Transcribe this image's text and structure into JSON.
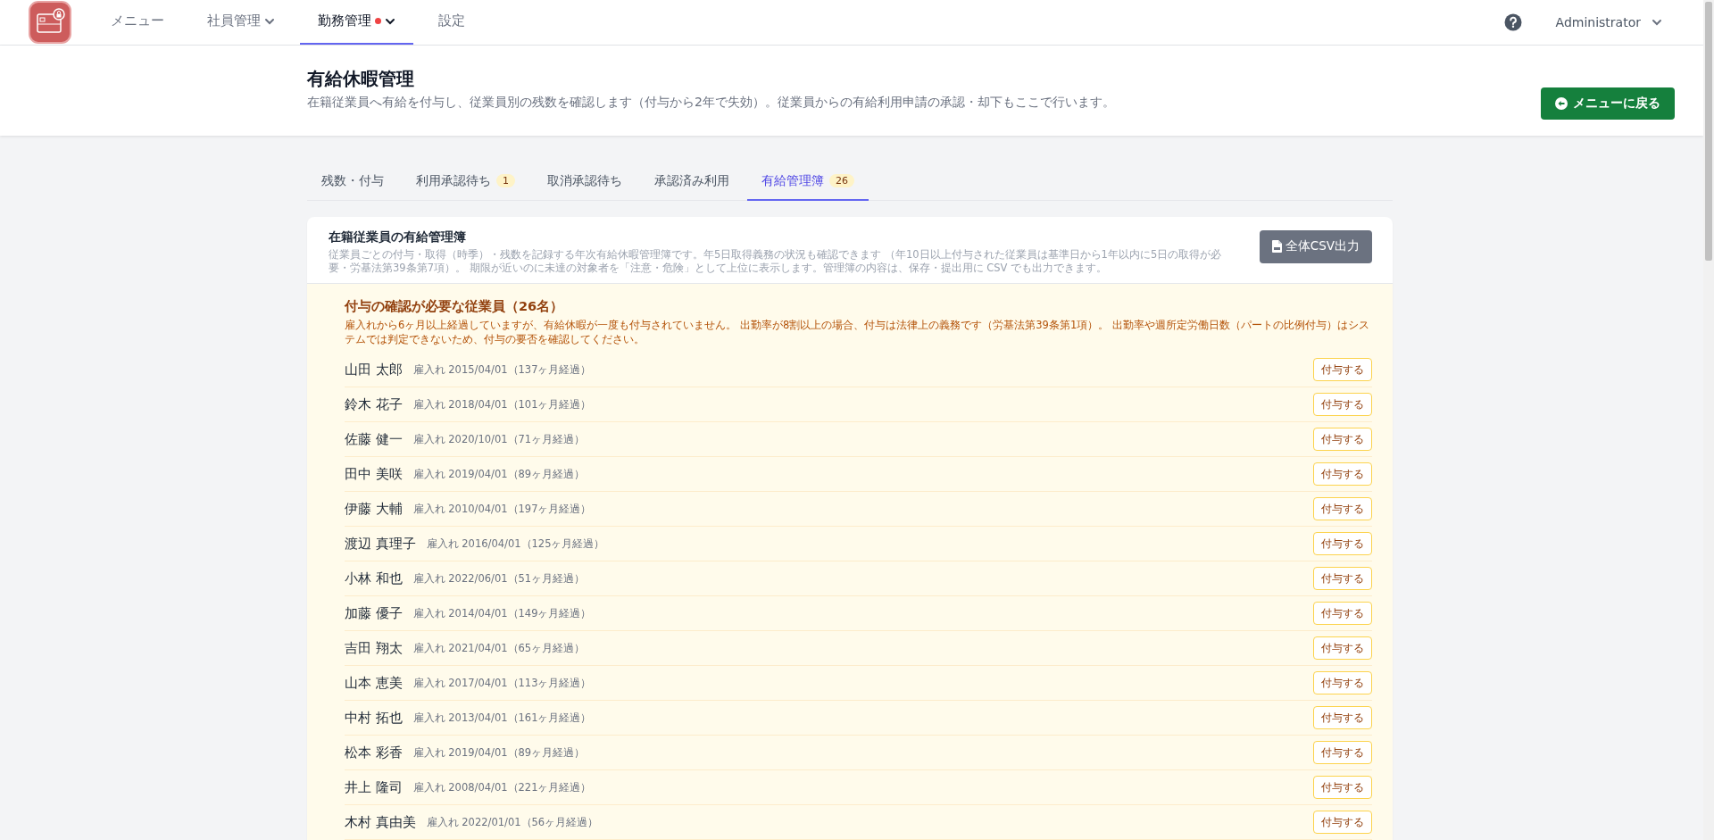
{
  "nav": {
    "items": [
      {
        "label": "メニュー",
        "selected": false,
        "dropdown": false,
        "alert": false
      },
      {
        "label": "社員管理",
        "selected": false,
        "dropdown": true,
        "alert": false
      },
      {
        "label": "勤務管理",
        "selected": true,
        "dropdown": true,
        "alert": true
      },
      {
        "label": "設定",
        "selected": false,
        "dropdown": false,
        "alert": false
      }
    ]
  },
  "user": {
    "name": "Administrator"
  },
  "header": {
    "title": "有給休暇管理",
    "subtitle": "在籍従業員へ有給を付与し、従業員別の残数を確認します（付与から2年で失効）。従業員からの有給利用申請の承認・却下もここで行います。",
    "back_button": "メニューに戻る"
  },
  "tabs": [
    {
      "label": "残数・付与",
      "selected": false
    },
    {
      "label": "利用承認待ち",
      "badge": "1",
      "selected": false
    },
    {
      "label": "取消承認待ち",
      "selected": false
    },
    {
      "label": "承認済み利用",
      "selected": false
    },
    {
      "label": "有給管理簿",
      "badge": "26",
      "selected": true
    }
  ],
  "ledger": {
    "title": "在籍従業員の有給管理簿",
    "description": "従業員ごとの付与・取得（時季）・残数を記録する年次有給休暇管理簿です。年5日取得義務の状況も確認できます （年10日以上付与された従業員は基準日から1年以内に5日の取得が必要・労基法第39条第7項）。 期限が近いのに未達の対象者を「注意・危険」として上位に表示します。管理簿の内容は、保存・提出用に CSV でも出力できます。",
    "csv_button": "全体CSV出力",
    "notice": {
      "title": "付与の確認が必要な従業員（26名）",
      "text": "雇入れから6ヶ月以上経過していますが、有給休暇が一度も付与されていません。 出勤率が8割以上の場合、付与は法律上の義務です（労基法第39条第1項）。 出勤率や週所定労働日数（パートの比例付与）はシステムでは判定できないため、付与の要否を確認してください。"
    },
    "employees": [
      {
        "name": "山田 太郎",
        "hired": "雇入れ 2015/04/01（137ヶ月経過）",
        "action": "付与する"
      },
      {
        "name": "鈴木 花子",
        "hired": "雇入れ 2018/04/01（101ヶ月経過）",
        "action": "付与する"
      },
      {
        "name": "佐藤 健一",
        "hired": "雇入れ 2020/10/01（71ヶ月経過）",
        "action": "付与する"
      },
      {
        "name": "田中 美咲",
        "hired": "雇入れ 2019/04/01（89ヶ月経過）",
        "action": "付与する"
      },
      {
        "name": "伊藤 大輔",
        "hired": "雇入れ 2010/04/01（197ヶ月経過）",
        "action": "付与する"
      },
      {
        "name": "渡辺 真理子",
        "hired": "雇入れ 2016/04/01（125ヶ月経過）",
        "action": "付与する"
      },
      {
        "name": "小林 和也",
        "hired": "雇入れ 2022/06/01（51ヶ月経過）",
        "action": "付与する"
      },
      {
        "name": "加藤 優子",
        "hired": "雇入れ 2014/04/01（149ヶ月経過）",
        "action": "付与する"
      },
      {
        "name": "吉田 翔太",
        "hired": "雇入れ 2021/04/01（65ヶ月経過）",
        "action": "付与する"
      },
      {
        "name": "山本 恵美",
        "hired": "雇入れ 2017/04/01（113ヶ月経過）",
        "action": "付与する"
      },
      {
        "name": "中村 拓也",
        "hired": "雇入れ 2013/04/01（161ヶ月経過）",
        "action": "付与する"
      },
      {
        "name": "松本 彩香",
        "hired": "雇入れ 2019/04/01（89ヶ月経過）",
        "action": "付与する"
      },
      {
        "name": "井上 隆司",
        "hired": "雇入れ 2008/04/01（221ヶ月経過）",
        "action": "付与する"
      },
      {
        "name": "木村 真由美",
        "hired": "雇入れ 2022/01/01（56ヶ月経過）",
        "action": "付与する"
      }
    ]
  }
}
